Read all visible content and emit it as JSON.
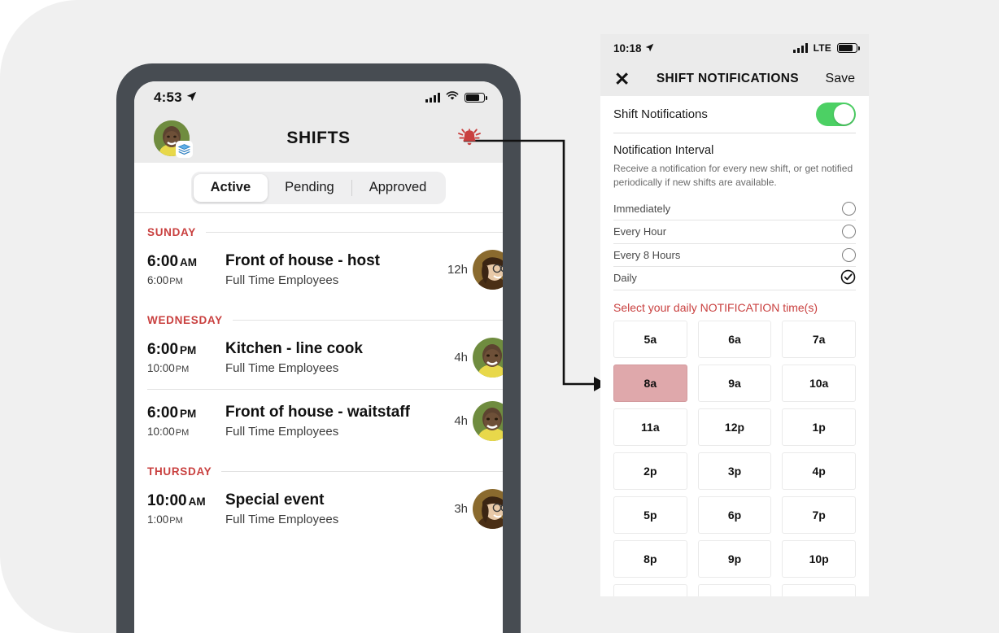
{
  "left_phone": {
    "status_bar": {
      "time": "4:53",
      "location_icon": "location-arrow-icon",
      "signal_icon": "signal-bars-icon",
      "wifi_icon": "wifi-icon",
      "battery_icon": "battery-icon"
    },
    "nav": {
      "avatar": "user-avatar",
      "avatar_badge_icon": "books-badge-icon",
      "title": "SHIFTS",
      "bell_icon": "notification-bell-icon",
      "bell_color": "#c9403f"
    },
    "tabs": [
      {
        "label": "Active",
        "selected": true
      },
      {
        "label": "Pending",
        "selected": false
      },
      {
        "label": "Approved",
        "selected": false
      }
    ],
    "groups": [
      {
        "day": "SUNDAY",
        "shifts": [
          {
            "start_time": "6:00",
            "start_meridiem": "AM",
            "end_time": "6:00",
            "end_meridiem": "PM",
            "title": "Front of house - host",
            "group": "Full Time Employees",
            "duration": "12h",
            "avatar": "employee-avatar-woman"
          }
        ]
      },
      {
        "day": "WEDNESDAY",
        "shifts": [
          {
            "start_time": "6:00",
            "start_meridiem": "PM",
            "end_time": "10:00",
            "end_meridiem": "PM",
            "title": "Kitchen - line cook",
            "group": "Full Time Employees",
            "duration": "4h",
            "avatar": "employee-avatar-man"
          },
          {
            "start_time": "6:00",
            "start_meridiem": "PM",
            "end_time": "10:00",
            "end_meridiem": "PM",
            "title": "Front of house - waitstaff",
            "group": "Full Time Employees",
            "duration": "4h",
            "avatar": "employee-avatar-man"
          }
        ]
      },
      {
        "day": "THURSDAY",
        "shifts": [
          {
            "start_time": "10:00",
            "start_meridiem": "AM",
            "end_time": "1:00",
            "end_meridiem": "PM",
            "title": "Special event",
            "group": "Full Time Employees",
            "duration": "3h",
            "avatar": "employee-avatar-woman"
          }
        ]
      }
    ]
  },
  "right_panel": {
    "status_bar": {
      "time": "10:18",
      "location_icon": "location-arrow-icon",
      "signal_icon": "signal-bars-icon",
      "network": "LTE",
      "battery_icon": "battery-icon"
    },
    "nav": {
      "close_label": "✕",
      "title": "SHIFT NOTIFICATIONS",
      "save_label": "Save"
    },
    "toggle_row": {
      "label": "Shift Notifications",
      "enabled": true,
      "on_color": "#4cd064"
    },
    "interval": {
      "title": "Notification Interval",
      "description": "Receive a notification for every new shift, or get notified periodically if new shifts are available.",
      "options": [
        {
          "label": "Immediately",
          "selected": false
        },
        {
          "label": "Every Hour",
          "selected": false
        },
        {
          "label": "Every 8 Hours",
          "selected": false
        },
        {
          "label": "Daily",
          "selected": true
        }
      ]
    },
    "time_picker": {
      "heading": "Select your daily NOTIFICATION time(s)",
      "heading_color": "#c9403f",
      "selected_color": "#dfa8ab",
      "selected": [
        "8a"
      ],
      "times": [
        "5a",
        "6a",
        "7a",
        "8a",
        "9a",
        "10a",
        "11a",
        "12p",
        "1p",
        "2p",
        "3p",
        "4p",
        "5p",
        "6p",
        "7p",
        "8p",
        "9p",
        "10p"
      ]
    }
  },
  "connector": {
    "icon": "arrow-connector",
    "color": "#111111"
  }
}
